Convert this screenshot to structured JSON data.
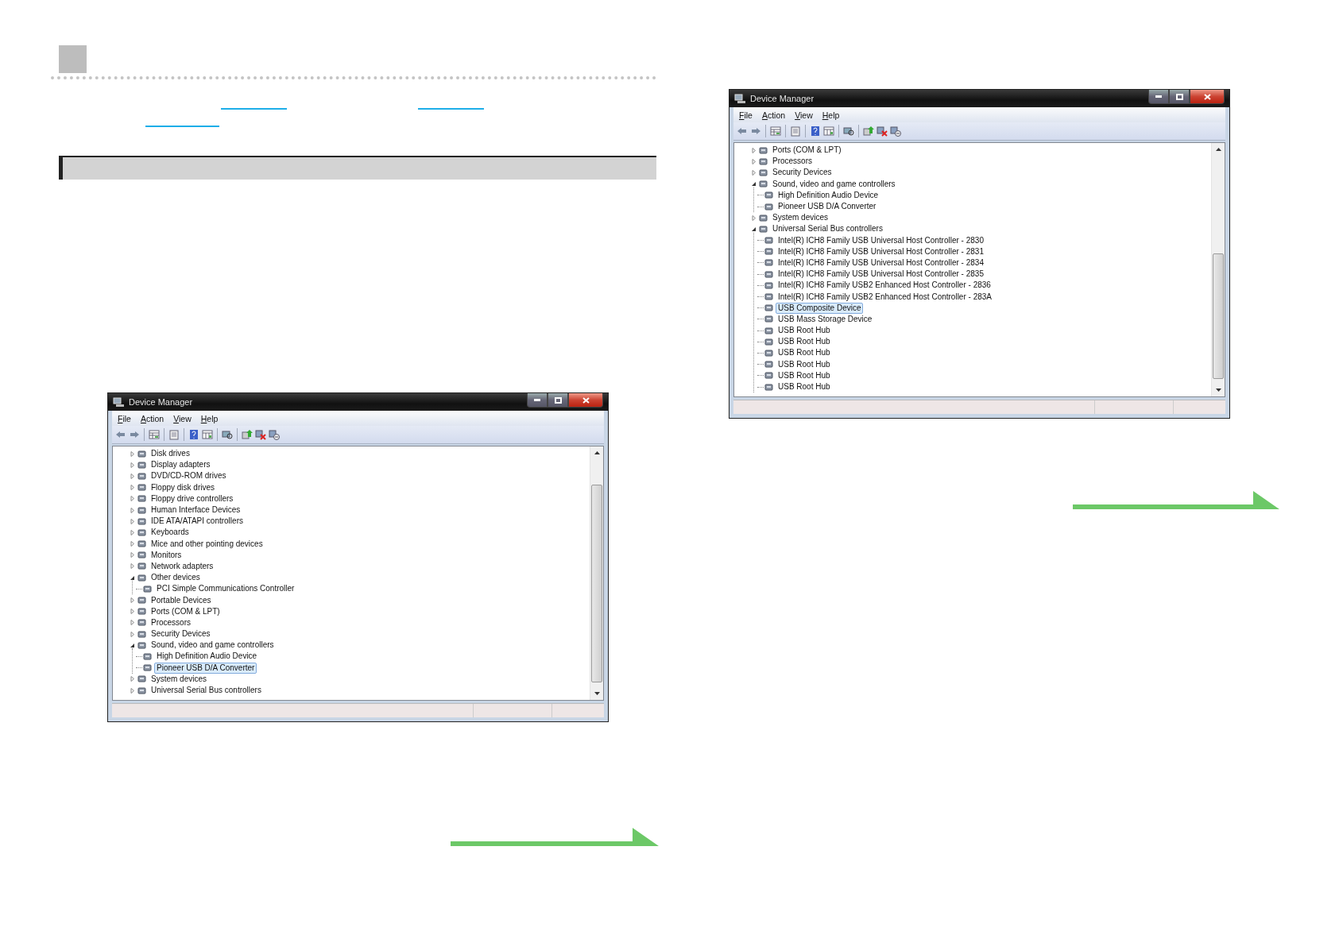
{
  "windows": [
    {
      "title": "Device Manager",
      "menu": [
        "File",
        "Action",
        "View",
        "Help"
      ],
      "tree": [
        {
          "label": "Disk drives",
          "expanded": false,
          "selected": false
        },
        {
          "label": "Display adapters",
          "expanded": false,
          "selected": false
        },
        {
          "label": "DVD/CD-ROM drives",
          "expanded": false,
          "selected": false
        },
        {
          "label": "Floppy disk drives",
          "expanded": false,
          "selected": false
        },
        {
          "label": "Floppy drive controllers",
          "expanded": false,
          "selected": false
        },
        {
          "label": "Human Interface Devices",
          "expanded": false,
          "selected": false
        },
        {
          "label": "IDE ATA/ATAPI controllers",
          "expanded": false,
          "selected": false
        },
        {
          "label": "Keyboards",
          "expanded": false,
          "selected": false
        },
        {
          "label": "Mice and other pointing devices",
          "expanded": false,
          "selected": false
        },
        {
          "label": "Monitors",
          "expanded": false,
          "selected": false
        },
        {
          "label": "Network adapters",
          "expanded": false,
          "selected": false
        },
        {
          "label": "Other devices",
          "expanded": true,
          "selected": false,
          "children": [
            {
              "label": "PCI Simple Communications Controller",
              "selected": false
            }
          ]
        },
        {
          "label": "Portable Devices",
          "expanded": false,
          "selected": false
        },
        {
          "label": "Ports (COM & LPT)",
          "expanded": false,
          "selected": false
        },
        {
          "label": "Processors",
          "expanded": false,
          "selected": false
        },
        {
          "label": "Security Devices",
          "expanded": false,
          "selected": false
        },
        {
          "label": "Sound, video and game controllers",
          "expanded": true,
          "selected": false,
          "children": [
            {
              "label": "High Definition Audio Device",
              "selected": false
            },
            {
              "label": "Pioneer USB D/A Converter",
              "selected": true
            }
          ]
        },
        {
          "label": "System devices",
          "expanded": false,
          "selected": false
        },
        {
          "label": "Universal Serial Bus controllers",
          "expanded": false,
          "selected": false
        }
      ]
    },
    {
      "title": "Device Manager",
      "menu": [
        "File",
        "Action",
        "View",
        "Help"
      ],
      "tree": [
        {
          "label": "Ports (COM & LPT)",
          "expanded": false,
          "selected": false
        },
        {
          "label": "Processors",
          "expanded": false,
          "selected": false
        },
        {
          "label": "Security Devices",
          "expanded": false,
          "selected": false
        },
        {
          "label": "Sound, video and game controllers",
          "expanded": true,
          "selected": false,
          "children": [
            {
              "label": "High Definition Audio Device",
              "selected": false
            },
            {
              "label": "Pioneer USB D/A Converter",
              "selected": false
            }
          ]
        },
        {
          "label": "System devices",
          "expanded": false,
          "selected": false
        },
        {
          "label": "Universal Serial Bus controllers",
          "expanded": true,
          "selected": false,
          "children": [
            {
              "label": "Intel(R) ICH8 Family USB Universal Host Controller - 2830",
              "selected": false
            },
            {
              "label": "Intel(R) ICH8 Family USB Universal Host Controller - 2831",
              "selected": false
            },
            {
              "label": "Intel(R) ICH8 Family USB Universal Host Controller - 2834",
              "selected": false
            },
            {
              "label": "Intel(R) ICH8 Family USB Universal Host Controller - 2835",
              "selected": false
            },
            {
              "label": "Intel(R) ICH8 Family USB2 Enhanced Host Controller - 2836",
              "selected": false
            },
            {
              "label": "Intel(R) ICH8 Family USB2 Enhanced Host Controller - 283A",
              "selected": false
            },
            {
              "label": "USB Composite Device",
              "selected": true
            },
            {
              "label": "USB Mass Storage Device",
              "selected": false
            },
            {
              "label": "USB Root Hub",
              "selected": false
            },
            {
              "label": "USB Root Hub",
              "selected": false
            },
            {
              "label": "USB Root Hub",
              "selected": false
            },
            {
              "label": "USB Root Hub",
              "selected": false
            },
            {
              "label": "USB Root Hub",
              "selected": false
            },
            {
              "label": "USB Root Hub",
              "selected": false
            }
          ]
        }
      ]
    }
  ]
}
